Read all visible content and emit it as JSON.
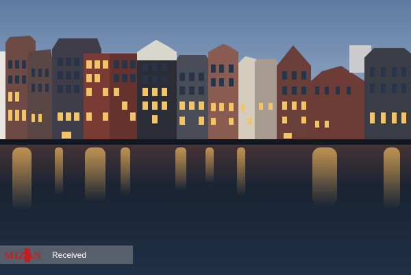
{
  "photo": {
    "subject": "canal-houses-at-dusk",
    "colors": {
      "sky_top": "#5e7aa0",
      "sky_bottom": "#a7b3c6",
      "water": "#1b2536",
      "window_light": "#f2c46a",
      "brick": "#6b3a33"
    }
  },
  "watermark": {
    "logo_text": "MIZAN",
    "label": "Received"
  }
}
